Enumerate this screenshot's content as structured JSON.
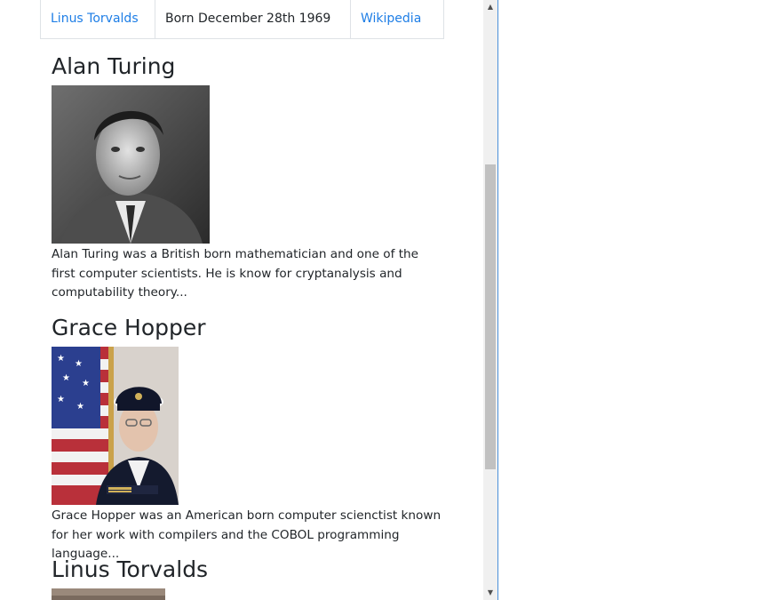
{
  "table_row": {
    "name": "Linus Torvalds",
    "born": "Born December 28th 1969",
    "link": "Wikipedia"
  },
  "people": [
    {
      "name": "Alan Turing",
      "description": "Alan Turing was a British born mathematician and one of the first computer scientists. He is know for cryptanalysis and computability theory..."
    },
    {
      "name": "Grace Hopper",
      "description": "Grace Hopper was an American born computer scienctist known for her work with compilers and the COBOL programming language..."
    },
    {
      "name": "Linus Torvalds"
    }
  ],
  "scrollbar": {
    "up_icon": "triangle-up",
    "down_icon": "triangle-down"
  }
}
